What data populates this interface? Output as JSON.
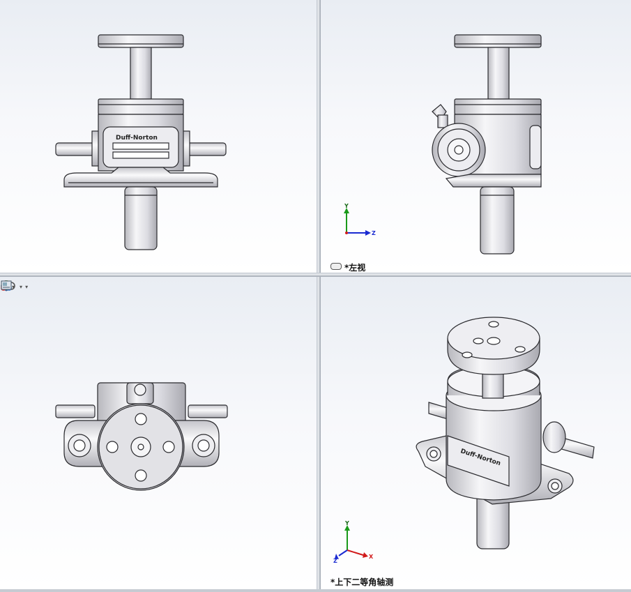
{
  "viewports": {
    "left_view": {
      "label": "*左视",
      "view_icon": "glasses-icon"
    },
    "isometric_view": {
      "label": "*上下二等角轴测"
    },
    "front_view": {},
    "top_view": {}
  },
  "triad": {
    "y_axis": "Y",
    "z_axis": "Z",
    "x_axis": "X"
  },
  "toolbar": {
    "items": [
      "view-orientation-icon",
      "display-style-icon",
      "hide-show-icon",
      "edit-appearance-icon",
      "apply-scene-icon",
      "view-settings-icon"
    ]
  },
  "nameplate": {
    "brand": "Duff-Norton"
  },
  "colors": {
    "x_axis": "#d11a1a",
    "y_axis": "#1a9a1a",
    "z_axis": "#1a2ad1",
    "part_fill": "#e4e4e8",
    "part_stroke": "#2a2a2e"
  }
}
